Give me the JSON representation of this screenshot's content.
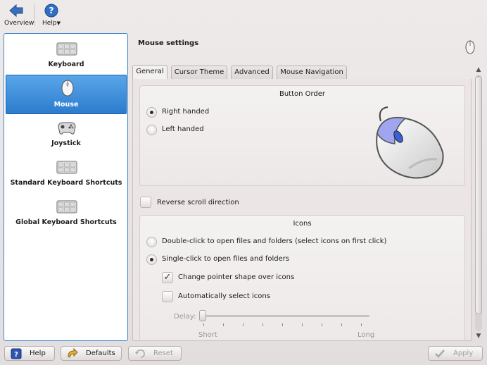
{
  "toolbar": {
    "overview_label": "Overview",
    "help_label": "Help"
  },
  "sidebar": {
    "items": [
      {
        "label": "Keyboard",
        "icon": "keyboard-icon"
      },
      {
        "label": "Mouse",
        "icon": "mouse-icon",
        "selected": true
      },
      {
        "label": "Joystick",
        "icon": "joystick-icon"
      },
      {
        "label": "Standard Keyboard Shortcuts",
        "icon": "keyboard-icon"
      },
      {
        "label": "Global Keyboard Shortcuts",
        "icon": "keyboard-icon"
      }
    ]
  },
  "main": {
    "title": "Mouse settings",
    "tabs": [
      "General",
      "Cursor Theme",
      "Advanced",
      "Mouse Navigation"
    ],
    "button_order": {
      "title": "Button Order",
      "right_handed": "Right handed",
      "left_handed": "Left handed",
      "selected": "Right handed"
    },
    "reverse_scroll": "Reverse scroll direction",
    "icons": {
      "title": "Icons",
      "double_click": "Double-click to open files and folders (select icons on first click)",
      "single_click": "Single-click to open files and folders",
      "change_pointer": "Change pointer shape over icons",
      "auto_select": "Automatically select icons",
      "delay_label": "Delay:",
      "short_label": "Short",
      "long_label": "Long"
    }
  },
  "footer": {
    "help": "Help",
    "defaults": "Defaults",
    "reset": "Reset",
    "apply": "Apply"
  },
  "colors": {
    "accent": "#3d88d1",
    "selection": "#2c7ccd"
  }
}
